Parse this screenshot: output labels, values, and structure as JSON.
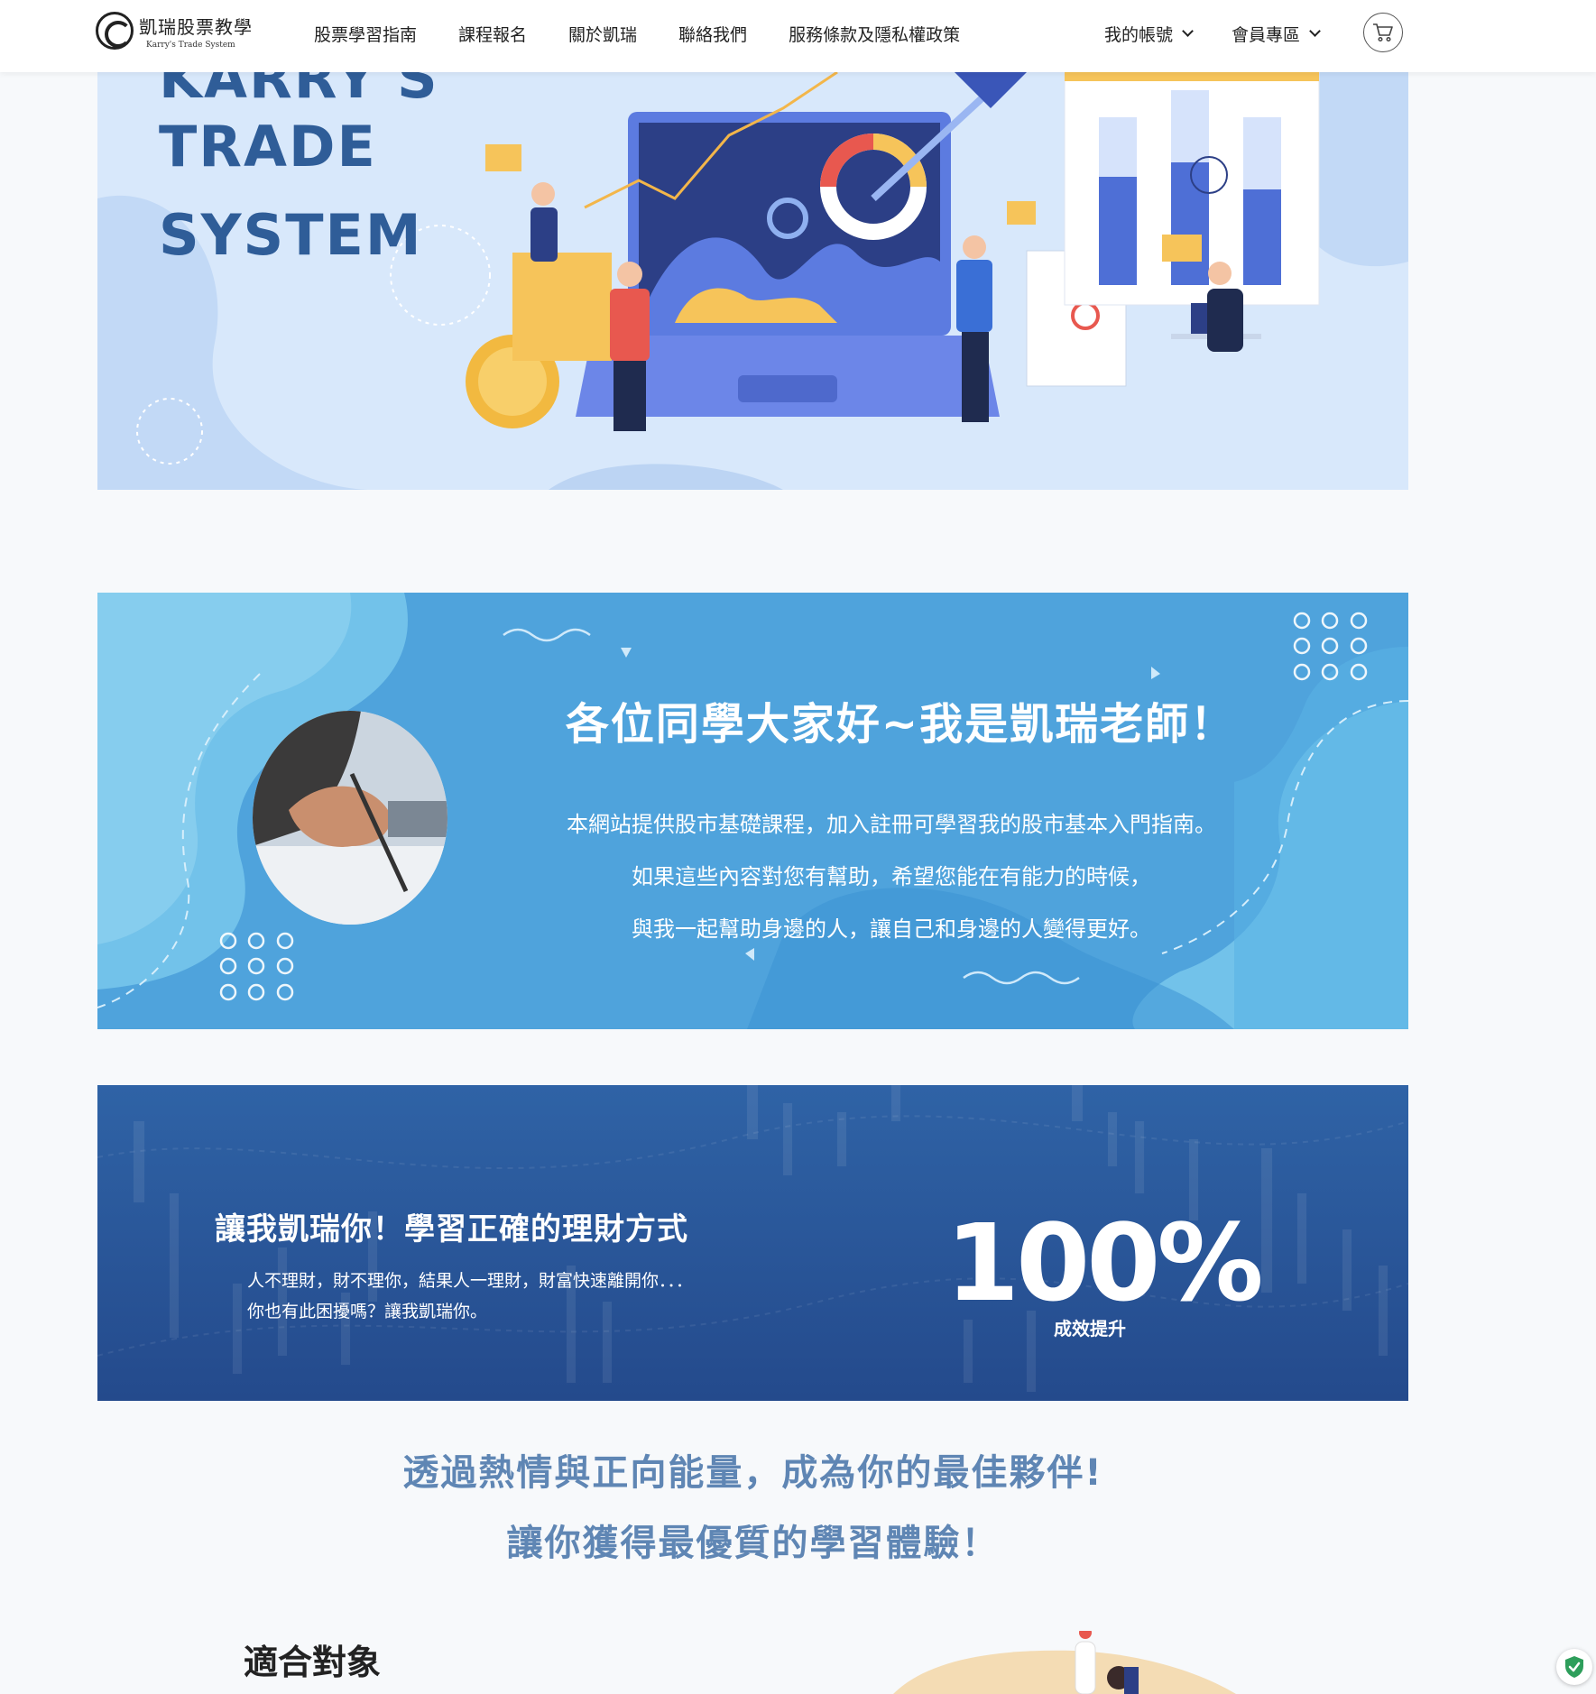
{
  "nav": {
    "logo_zh": "凱瑞股票教學",
    "logo_en": "Karry's  Trade System",
    "links": [
      "股票學習指南",
      "課程報名",
      "關於凱瑞",
      "聯絡我們",
      "服務條款及隱私權政策"
    ],
    "account_label": "我的帳號",
    "member_label": "會員專區"
  },
  "hero": {
    "title_lines": [
      "KARRY'S",
      "TRADE",
      "SYSTEM"
    ]
  },
  "intro": {
    "heading": "各位同學大家好~我是凱瑞老師！",
    "lines": [
      "本網站提供股市基礎課程，加入註冊可學習我的股市基本入門指南。",
      "如果這些內容對您有幫助，希望您能在有能力的時候，",
      "與我一起幫助身邊的人，讓自己和身邊的人變得更好。"
    ]
  },
  "stats": {
    "heading": "讓我凱瑞你！學習正確的理財方式",
    "lines": [
      "人不理財，財不理你，結果人一理財，財富快速離開你．．．",
      "你也有此困擾嗎？讓我凱瑞你。"
    ],
    "number": "100%",
    "caption": "成效提升"
  },
  "slogan": {
    "line1": "透過熱情與正向能量，成為你的最佳夥伴!",
    "line2": "讓你獲得最優質的學習體驗！"
  },
  "target": {
    "title": "適合對象"
  },
  "colors": {
    "hero_title": "#2f5d98",
    "intro_bg": "#4fa3dc",
    "stats_bg": "#244a8c",
    "slogan": "#5f86b4"
  }
}
